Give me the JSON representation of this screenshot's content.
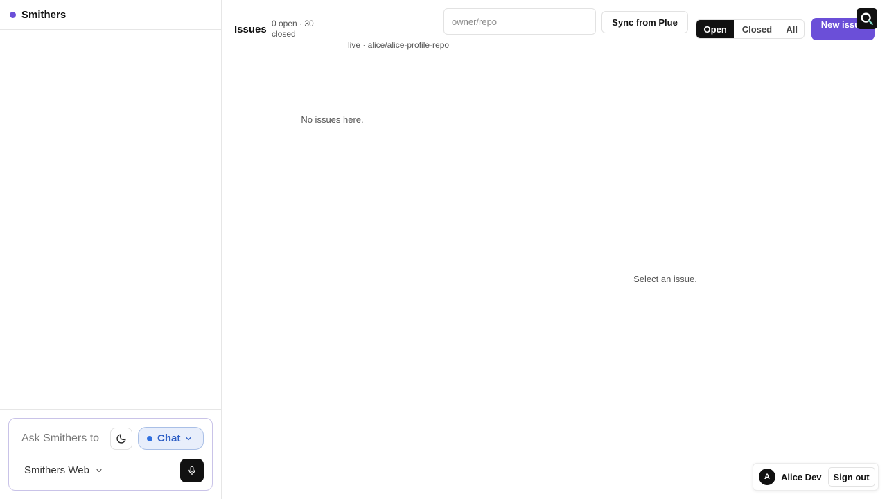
{
  "brand": {
    "name": "Smithers",
    "dot_color": "#6b4fd8"
  },
  "composer": {
    "placeholder": "Ask Smithers to",
    "theme_icon": "moon-icon",
    "mode_label": "Chat",
    "mode_dot_color": "#2f6fe0",
    "target_label": "Smithers Web",
    "mic_icon": "microphone-icon"
  },
  "header": {
    "title": "Issues",
    "counts": "0 open · 30 closed",
    "status": "live · alice/alice-profile-repo",
    "repo_placeholder": "owner/repo",
    "sync_label": "Sync from Plue",
    "filters": [
      "Open",
      "Closed",
      "All"
    ],
    "active_filter": "Open",
    "new_issue_label": "New issue",
    "accent_color": "#6b4fd8"
  },
  "list": {
    "empty_text": "No issues here."
  },
  "detail": {
    "empty_text": "Select an issue."
  },
  "account": {
    "avatar_initial": "A",
    "name": "Alice Dev",
    "sign_out_label": "Sign out"
  }
}
